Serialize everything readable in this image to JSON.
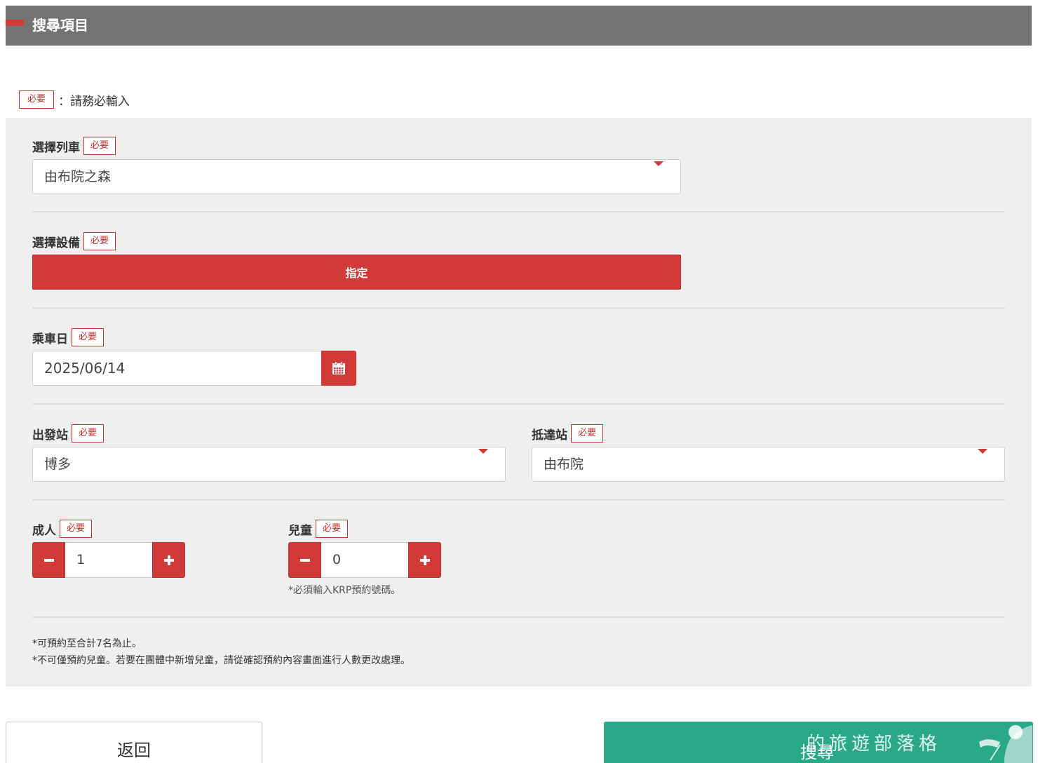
{
  "header": {
    "title": "搜尋項目"
  },
  "legend": {
    "tag": "必要",
    "text": "：請務必輸入"
  },
  "required_tag": "必要",
  "train": {
    "label": "選擇列車",
    "value": "由布院之森"
  },
  "equipment": {
    "label": "選擇設備",
    "button": "指定"
  },
  "date": {
    "label": "乘車日",
    "value": "2025/06/14",
    "icon": "calendar-icon"
  },
  "departure": {
    "label": "出發站",
    "value": "博多"
  },
  "arrival": {
    "label": "抵達站",
    "value": "由布院"
  },
  "adults": {
    "label": "成人",
    "value": "1"
  },
  "children": {
    "label": "兒童",
    "value": "0",
    "note": "*必須輸入KRP預約號碼。"
  },
  "notes": [
    "*可預約至合計7名為止。",
    "*不可僅預約兒童。若要在團體中新增兒童，請從確認預約內容畫面進行人數更改處理。"
  ],
  "buttons": {
    "back": "返回",
    "search": "搜尋"
  },
  "watermark": "的旅遊部落格",
  "colors": {
    "accent": "#d13a37",
    "header": "#737373",
    "panel": "#efefef",
    "search": "#2aa987"
  }
}
